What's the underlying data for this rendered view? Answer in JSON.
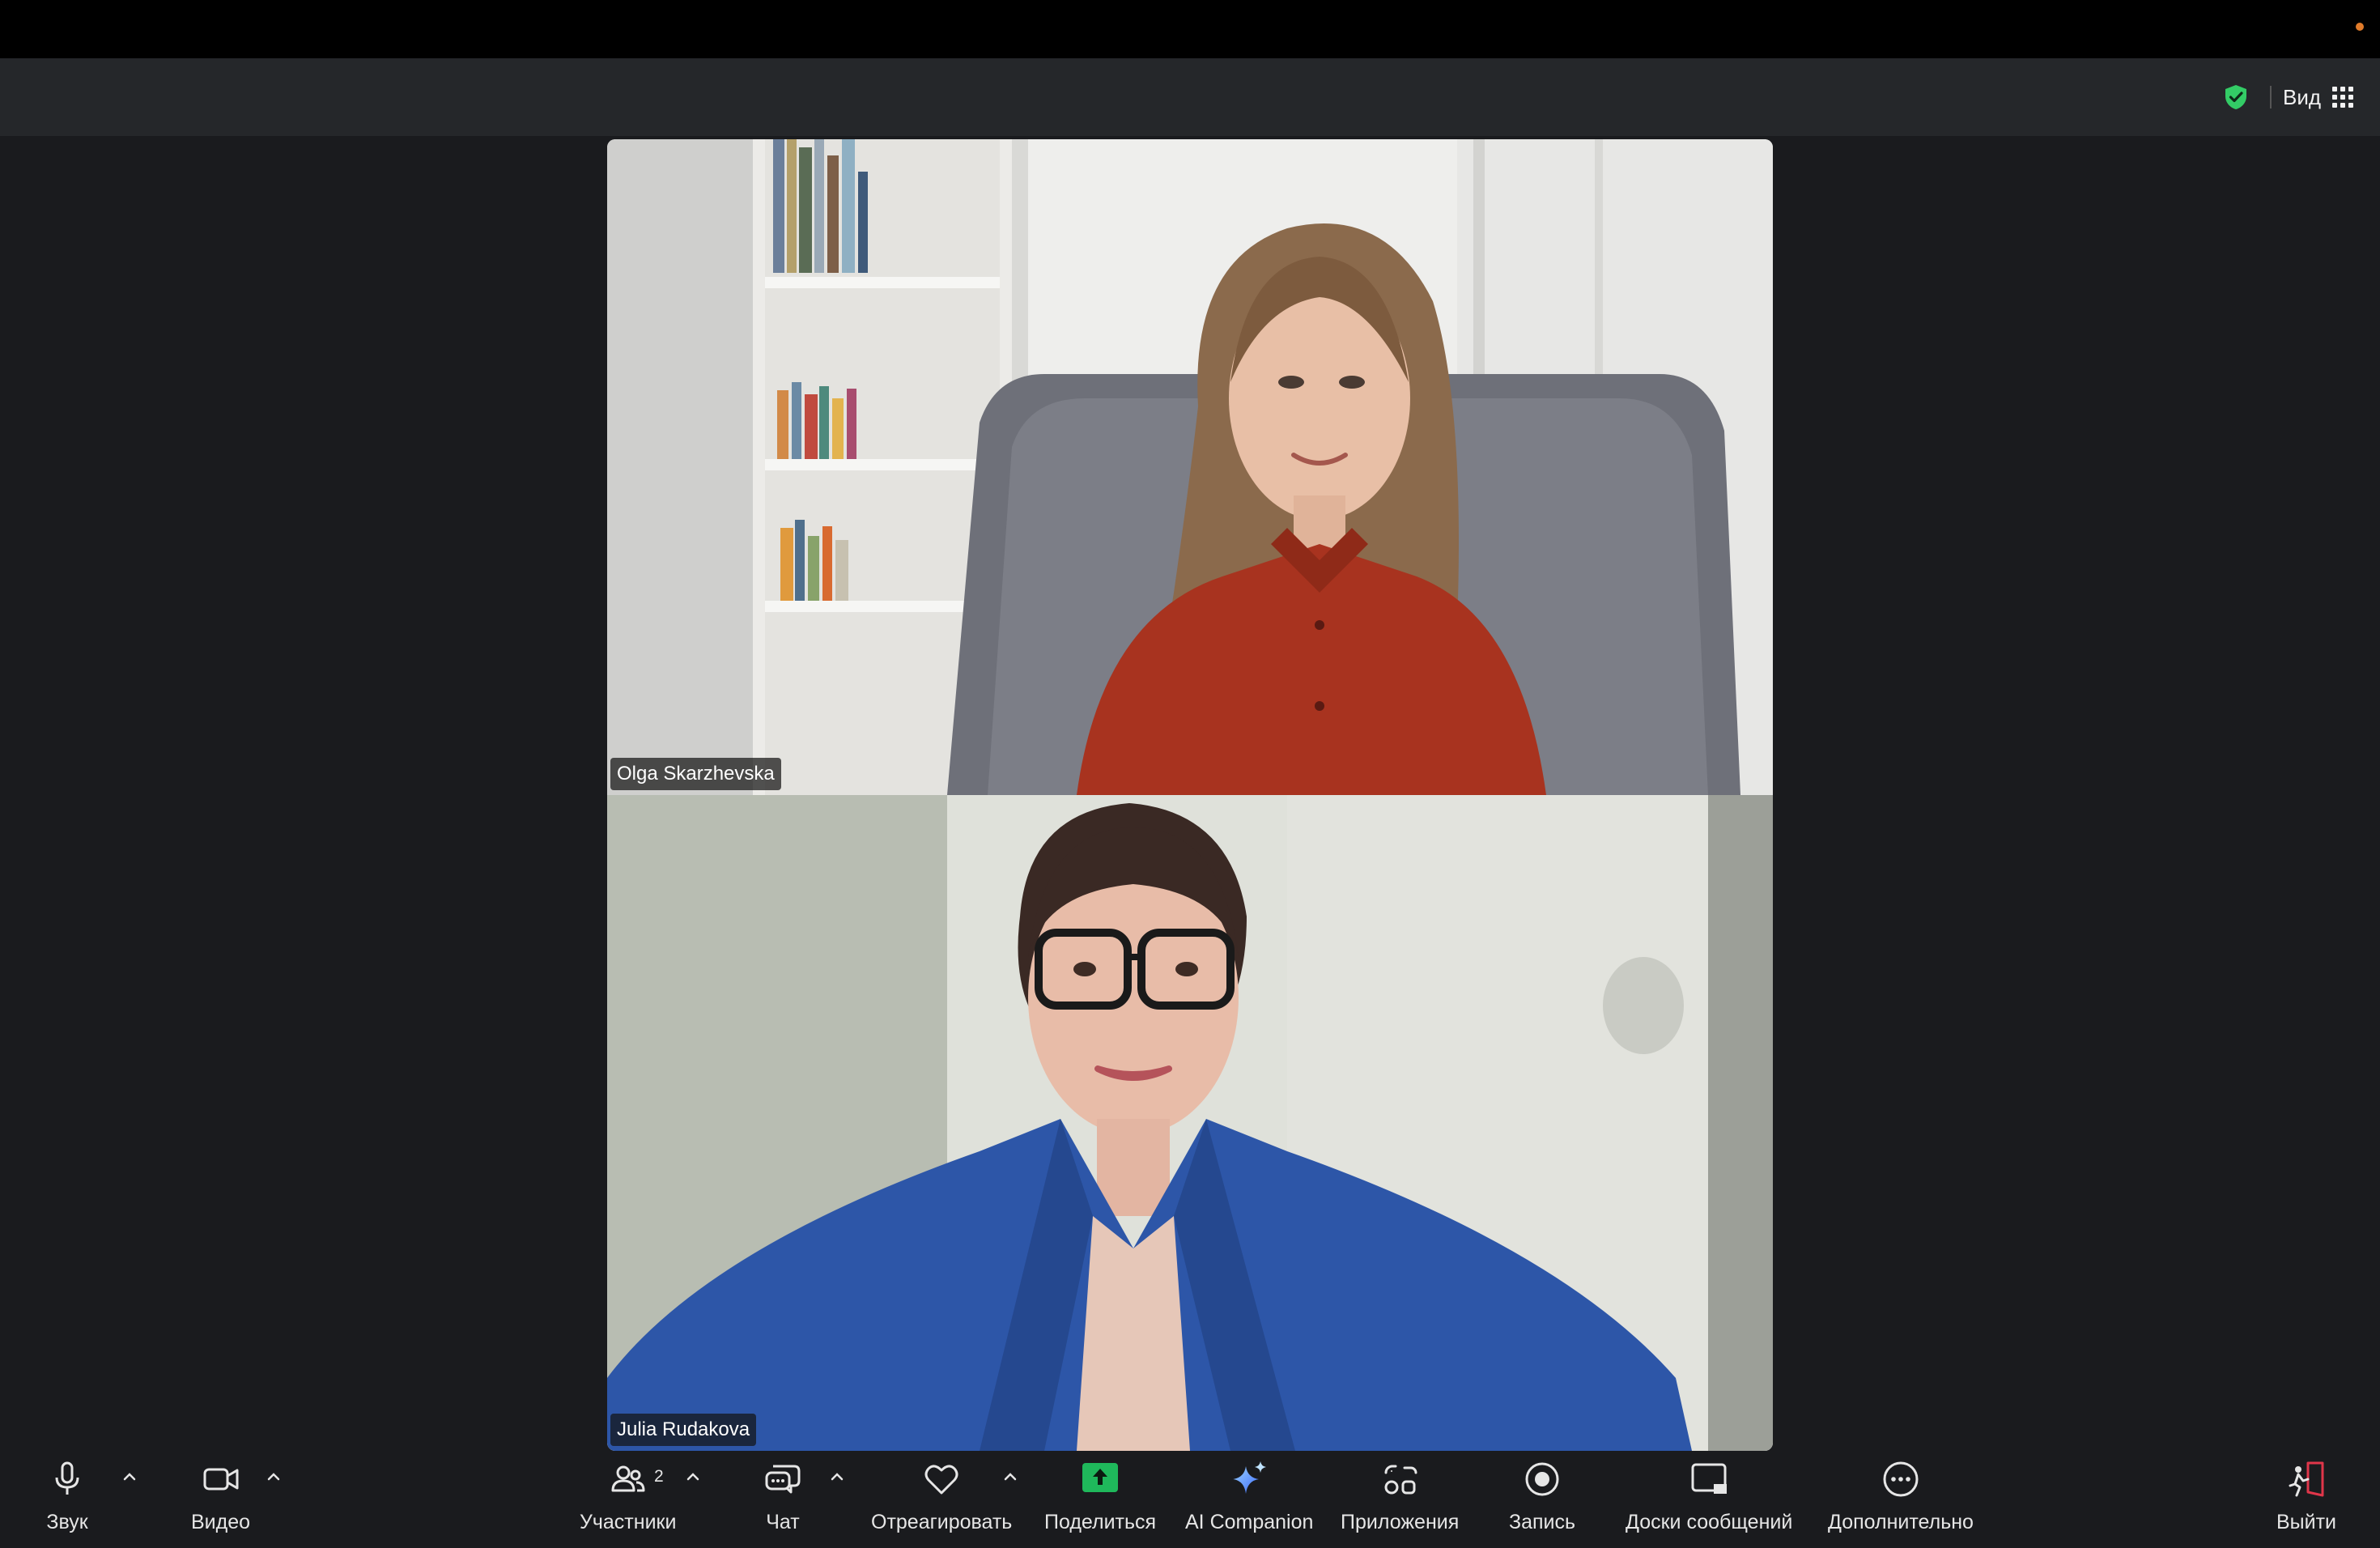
{
  "top_bar": {
    "view_label": "Вид"
  },
  "participants": [
    {
      "name": "Olga Skarzhevska"
    },
    {
      "name": "Julia Rudakova"
    }
  ],
  "toolbar": {
    "audio_label": "Звук",
    "video_label": "Видео",
    "participants_label": "Участники",
    "participants_count": "2",
    "chat_label": "Чат",
    "react_label": "Отреагировать",
    "share_label": "Поделиться",
    "ai_label": "AI Companion",
    "apps_label": "Приложения",
    "record_label": "Запись",
    "whiteboards_label": "Доски сообщений",
    "more_label": "Дополнительно",
    "leave_label": "Выйти"
  },
  "colors": {
    "background": "#1a1b1e",
    "top_bar": "#25272a",
    "security_green": "#33cc66",
    "share_green": "#1fb85b",
    "leave_red": "#e0364a"
  }
}
